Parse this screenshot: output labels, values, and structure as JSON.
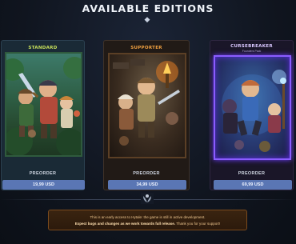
{
  "header": {
    "title": "AVAILABLE EDITIONS",
    "ornament_icon": "diamond-ornament-icon"
  },
  "editions": [
    {
      "name": "STANDARD",
      "subtitle": "",
      "action_label": "PREORDER",
      "price": "19,99 USD",
      "accent_color": "#c8e15a"
    },
    {
      "name": "SUPPORTER",
      "subtitle": "",
      "action_label": "PREORDER",
      "price": "34,99 USD",
      "accent_color": "#f0a040"
    },
    {
      "name": "CURSEBREAKER",
      "subtitle": "Founders Pack",
      "action_label": "PREORDER",
      "price": "69,99 USD",
      "accent_color": "#8a5cff"
    }
  ],
  "notice": {
    "line1": "This is an early access to Hytale: the game is still in active development.",
    "line2_bold": "Expect bugs and changes as we work towards full release.",
    "line2_rest": " Thank you for your support!"
  },
  "colors": {
    "price_button": "#5a76b4",
    "notice_border": "#7a4a1c",
    "background": "#10151f"
  }
}
